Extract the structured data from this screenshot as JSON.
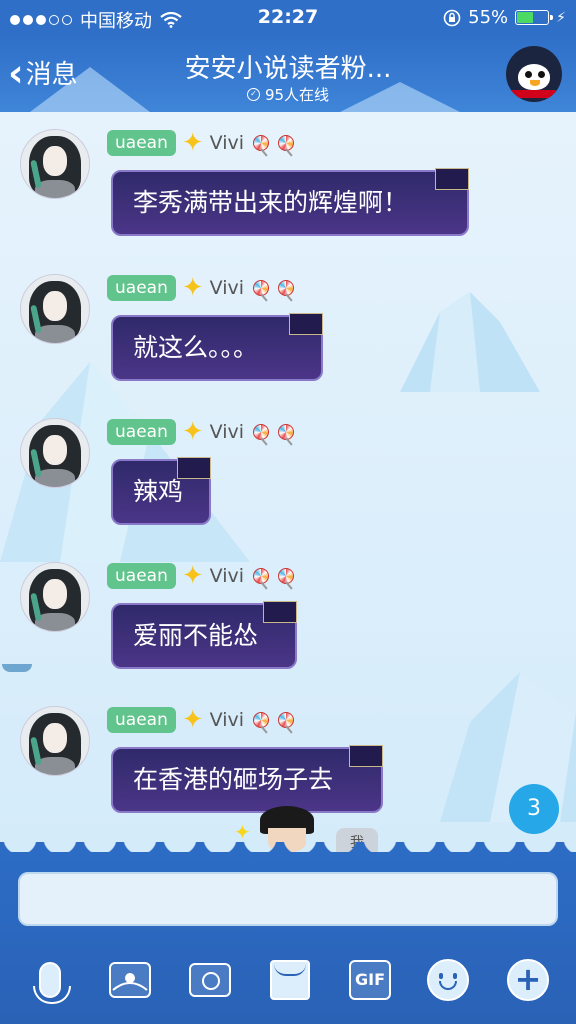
{
  "status_bar": {
    "carrier": "中国移动",
    "time": "22:27",
    "battery_percent": "55%",
    "battery_level": 0.55,
    "icons": [
      "signal-dots-icon",
      "wifi-icon",
      "orientation-lock-icon",
      "battery-icon",
      "charging-icon"
    ]
  },
  "nav": {
    "back_label": "消息",
    "title": "安安小说读者粉...",
    "online_count": "95人在线",
    "icons": [
      "back-chevron-icon",
      "online-check-icon",
      "group-avatar-penguin-icon"
    ]
  },
  "messages": [
    {
      "tag": "uaean",
      "nickname": "Vivi",
      "text": "李秀满带出来的辉煌啊！"
    },
    {
      "tag": "uaean",
      "nickname": "Vivi",
      "text": "就这么。。。"
    },
    {
      "tag": "uaean",
      "nickname": "Vivi",
      "text": "辣鸡"
    },
    {
      "tag": "uaean",
      "nickname": "Vivi",
      "text": "爱丽不能怂"
    },
    {
      "tag": "uaean",
      "nickname": "Vivi",
      "text": "在香港的砸场子去"
    }
  ],
  "self": {
    "badge": "我"
  },
  "unread_count": "3",
  "input": {
    "placeholder": ""
  },
  "toolbar": {
    "gif_label": "GIF",
    "icons": [
      "microphone-icon",
      "photo-album-icon",
      "camera-icon",
      "red-packet-icon",
      "gif-icon",
      "emoji-icon",
      "plus-icon"
    ]
  },
  "colors": {
    "header_blue": "#2f6fc8",
    "bubble_purple": "#3b2f7a",
    "tag_green": "#62c48d",
    "unread_blue": "#25a7e8"
  }
}
